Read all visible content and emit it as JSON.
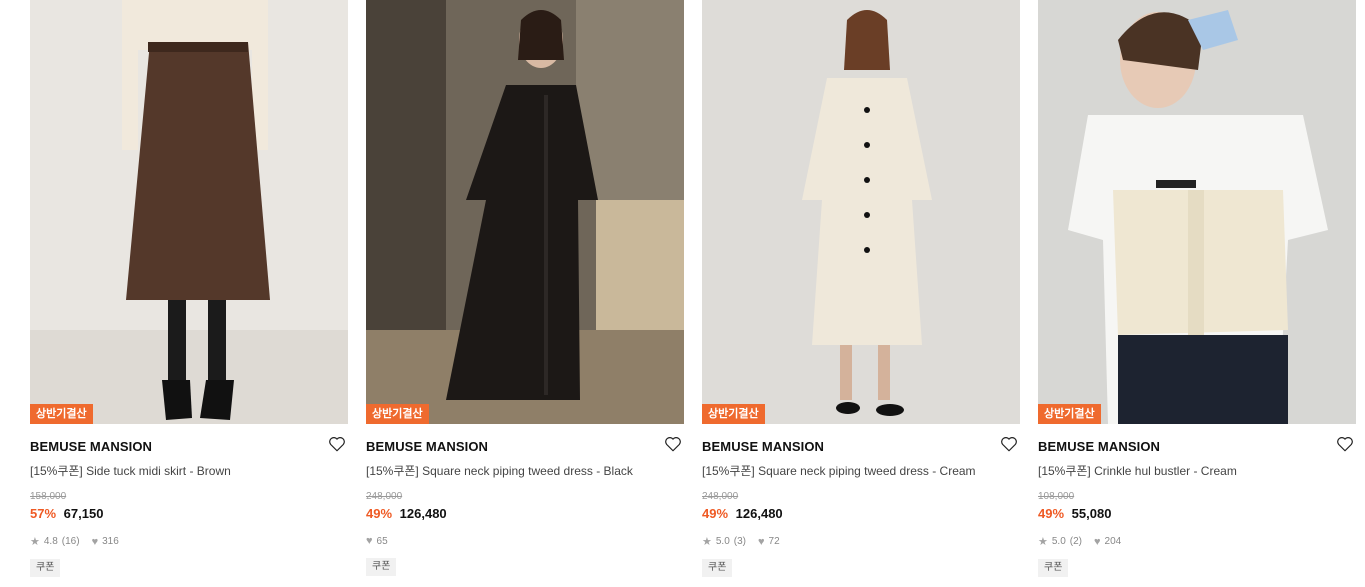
{
  "products": [
    {
      "tag": "상반기결산",
      "brand": "BEMUSE MANSION",
      "name": "[15%쿠폰] Side tuck midi skirt - Brown",
      "original_price": "158,000",
      "discount": "57%",
      "price": "67,150",
      "rating": "4.8",
      "reviews": "(16)",
      "likes": "316",
      "badge": "쿠폰"
    },
    {
      "tag": "상반기결산",
      "brand": "BEMUSE MANSION",
      "name": "[15%쿠폰] Square neck piping tweed dress - Black",
      "original_price": "248,000",
      "discount": "49%",
      "price": "126,480",
      "rating": "",
      "reviews": "",
      "likes": "65",
      "badge": "쿠폰"
    },
    {
      "tag": "상반기결산",
      "brand": "BEMUSE MANSION",
      "name": "[15%쿠폰] Square neck piping tweed dress - Cream",
      "original_price": "248,000",
      "discount": "49%",
      "price": "126,480",
      "rating": "5.0",
      "reviews": "(3)",
      "likes": "72",
      "badge": "쿠폰"
    },
    {
      "tag": "상반기결산",
      "brand": "BEMUSE MANSION",
      "name": "[15%쿠폰] Crinkle hul bustler - Cream",
      "original_price": "108,000",
      "discount": "49%",
      "price": "55,080",
      "rating": "5.0",
      "reviews": "(2)",
      "likes": "204",
      "badge": "쿠폰"
    }
  ],
  "icons": {
    "star": "star-icon",
    "like": "heart-icon",
    "wish": "heart-outline-icon"
  },
  "colors": {
    "tag_bg": "#ef6a2e",
    "discount": "#ef5a24"
  }
}
